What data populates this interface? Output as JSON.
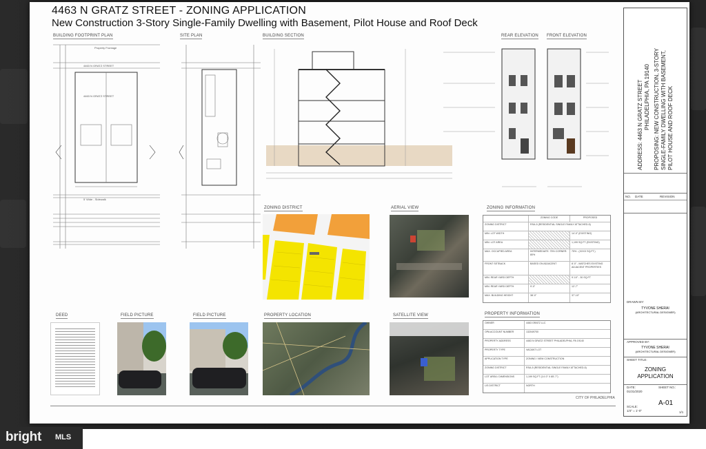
{
  "sheet": {
    "title": "4463 N GRATZ STREET - ZONING APPLICATION",
    "subtitle": "New Construction 3-Story Single-Family Dwelling with Basement, Pilot House and Roof Deck"
  },
  "panels": {
    "building_footprint": "BUILDING FOOTPRINT PLAN",
    "site_plan": "SITE PLAN",
    "building_section": "BUILDING SECTION",
    "rear_elevation": "REAR ELEVATION",
    "front_elevation": "FRONT ELEVATION",
    "zoning_district": "ZONING DISTRICT",
    "aerial_view": "AERIAL VIEW",
    "zoning_information": "ZONING INFORMATION",
    "deed": "DEED",
    "field_picture_1": "FIELD PICTURE",
    "field_picture_2": "FIELD PICTURE",
    "property_location": "PROPERTY LOCATION",
    "satellite_view": "SATELLITE VIEW",
    "property_information": "PROPERTY INFORMATION"
  },
  "plan_text": {
    "property_frontage": "Property Frontage",
    "street_name": "4463 N GRATZ STREET",
    "sidewalk": "5' Wide - Sidewalk"
  },
  "title_block": {
    "address_line_1": "ADDRESS: 4463 N GRATZ STREET",
    "address_line_2": "PHILADELPHIA, PA 19140",
    "proposing_line_1": "PROPOSING: NEW CONSTRUCTION, 3-STORY",
    "proposing_line_2": "SINGLE-FAMILY DWELLING WITH BASEMENT,",
    "proposing_line_3": "PILOT HOUSE AND ROOF DECK",
    "rev_headers": [
      "NO.",
      "DATE",
      "REVISION"
    ],
    "drawn_by": "DRAWN BY:",
    "designer_1": "TYVONE SHERAI",
    "designer_1_role": "(ARCHITECTURAL DESIGNER)",
    "approved_by": "APPROVED BY:",
    "designer_2": "TYVONE SHERAI",
    "designer_2_role": "(ARCHITECTURAL DESIGNER)",
    "sheet_title_label": "SHEET TITLE:",
    "sheet_title_1": "ZONING",
    "sheet_title_2": "APPLICATION",
    "date_label": "DATE:",
    "date_value": "01/31/2020",
    "sheet_no_label": "SHEET NO.:",
    "scale_label": "SCALE:",
    "scale_value": "1/4\" = 1'-0\"",
    "sheet_no": "A-01",
    "page": "1/1"
  },
  "zoning_table": {
    "headers": [
      "",
      "ZONING CODE",
      "PROPOSED"
    ],
    "rows": [
      [
        "ZONING DISTRICT",
        "RSA-5 (RESIDENTIAL SINGLE FAMILY ATTACHED-5)",
        ""
      ],
      [
        "MIN. LOT WIDTH",
        "",
        "14'-0\" (EXISTING)"
      ],
      [
        "MIN. LOT AREA",
        "",
        "1,199 SQ.FT (EXISTING)"
      ],
      [
        "MAX. OCCUPIED AREA",
        "INTERMEDIATE: 75% CORNER: 80%",
        "75% - (xxxx SQ.FT.)"
      ],
      [
        "FRONT SETBACK",
        "BASED ON ADJACENT",
        "8'-0\" - MATCHES EXISTING ADJACENT PROPERTIES"
      ],
      [
        "MIN. REAR YARD DEPTH",
        "",
        "9'-10\" - 30 SQ.FT"
      ],
      [
        "MIN. REAR YARD DEPTH",
        "9'-0\"",
        "12'-7\""
      ],
      [
        "MAX. BUILDING HEIGHT",
        "38'-0\"",
        "37'-10\""
      ]
    ]
  },
  "property_table": {
    "rows": [
      [
        "OWNER",
        "4463 GRATZ LLC"
      ],
      [
        "OPA ACCOUNT NUMBER",
        "132049700"
      ],
      [
        "PROPERTY ADDRESS",
        "4463 N GRATZ STREET PHILADELPHIA, PA 19140"
      ],
      [
        "PROPERTY TYPE",
        "VACANT LOT"
      ],
      [
        "APPLICATION TYPE",
        "ZONING / NEW CONSTRUCTION"
      ],
      [
        "ZONING DISTRICT",
        "RSA-5 (RESIDENTIAL SINGLE FAMILY ATTACHED-5)"
      ],
      [
        "LOT AREA / DIMENSIONS",
        "1,199 SQ.FT (14'-0\" x 85'-7\")"
      ],
      [
        "LIS DISTRICT",
        "NORTH"
      ]
    ],
    "footer": "CITY OF PHILADELPHIA"
  },
  "watermark": {
    "brand": "bright",
    "suffix": "MLS"
  }
}
